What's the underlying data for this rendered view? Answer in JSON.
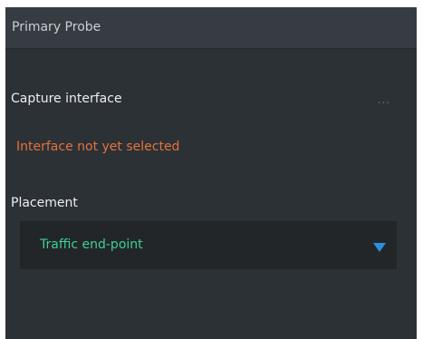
{
  "panel": {
    "title": "Primary Probe"
  },
  "capture": {
    "label": "Capture interface",
    "more_label": "...",
    "status": "Interface not yet selected",
    "status_color": "#e2733d"
  },
  "placement": {
    "label": "Placement",
    "selected": "Traffic end-point",
    "selected_color": "#3dcf94",
    "arrow_icon": "triangle-down-icon",
    "arrow_color": "#2a8fe0"
  }
}
